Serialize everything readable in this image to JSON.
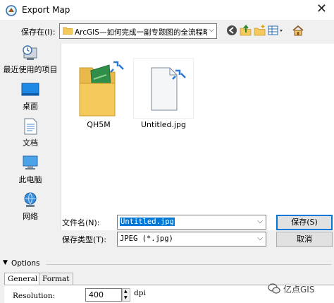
{
  "window": {
    "title": "Export Map"
  },
  "toolbar": {
    "save_in_label": "保存在(I):",
    "current_folder": "ArcGIS—如何完成一副专题图的全流程略"
  },
  "places": [
    {
      "label": "最近使用的项目",
      "icon": "recent-icon"
    },
    {
      "label": "桌面",
      "icon": "desktop-icon"
    },
    {
      "label": "文档",
      "icon": "documents-icon"
    },
    {
      "label": "此电脑",
      "icon": "this-pc-icon"
    },
    {
      "label": "网络",
      "icon": "network-icon"
    }
  ],
  "files": [
    {
      "name": "QH5M",
      "icon": "folder-icon"
    },
    {
      "name": "Untitled.jpg",
      "icon": "image-file-icon"
    }
  ],
  "form": {
    "filename_label": "文件名(N):",
    "filename_value": "Untitled.jpg",
    "filetype_label": "保存类型(T):",
    "filetype_value": "JPEG (*.jpg)",
    "save_button": "保存(S)",
    "cancel_button": "取消"
  },
  "options": {
    "label": "Options",
    "tabs": [
      "General",
      "Format"
    ],
    "resolution_label": "Resolution:",
    "resolution_value": "400",
    "resolution_unit": "dpi"
  },
  "watermark": {
    "text": "亿点GIS"
  },
  "colors": {
    "accent": "#0078d7",
    "folder": "#f5c95b"
  }
}
